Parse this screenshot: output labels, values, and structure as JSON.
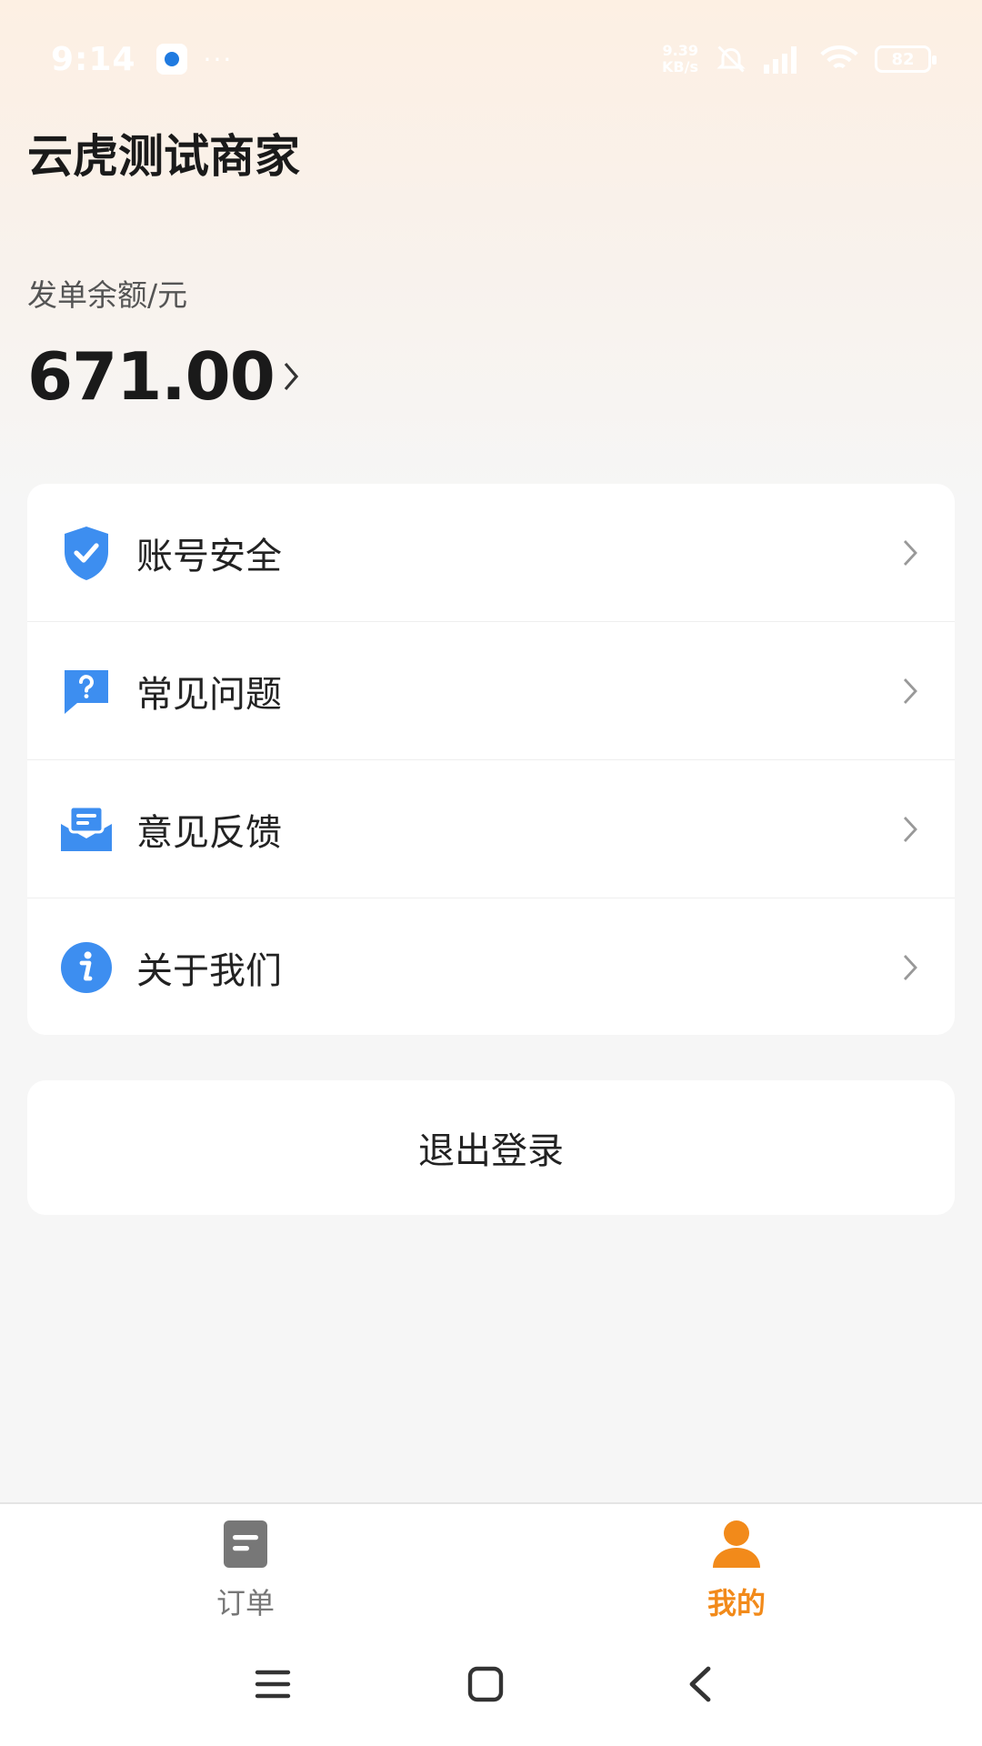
{
  "status_bar": {
    "time": "9:14",
    "dots": "···",
    "net_speed_value": "9.39",
    "net_speed_unit": "KB/s",
    "battery": "82"
  },
  "header": {
    "merchant_name": "云虎测试商家"
  },
  "balance": {
    "label": "发单余额/元",
    "value": "671.00"
  },
  "menu": {
    "items": [
      {
        "label": "账号安全",
        "icon": "shield-check-icon"
      },
      {
        "label": "常见问题",
        "icon": "question-bubble-icon"
      },
      {
        "label": "意见反馈",
        "icon": "feedback-mail-icon"
      },
      {
        "label": "关于我们",
        "icon": "info-icon"
      }
    ]
  },
  "logout": {
    "label": "退出登录"
  },
  "tabs": [
    {
      "label": "订单",
      "icon": "document-icon",
      "active": false
    },
    {
      "label": "我的",
      "icon": "user-icon",
      "active": true
    }
  ],
  "colors": {
    "accent": "#f28a1a",
    "icon_blue": "#3d8ef0",
    "inactive_tab": "#777777"
  }
}
